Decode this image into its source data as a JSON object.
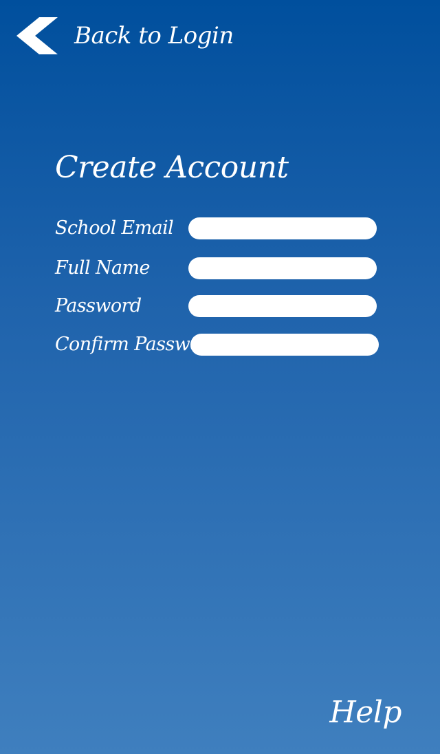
{
  "navigation": {
    "back_label": "Back to Login",
    "back_icon": "chevron-left-icon"
  },
  "page": {
    "title": "Create Account"
  },
  "form": {
    "fields": [
      {
        "label": "School Email",
        "value": ""
      },
      {
        "label": "Full Name",
        "value": ""
      },
      {
        "label": "Password",
        "value": ""
      },
      {
        "label": "Confirm Password",
        "value": ""
      }
    ]
  },
  "footer": {
    "help_label": "Help"
  },
  "colors": {
    "background_top": "#004f9d",
    "background_bottom": "#3f7fbe",
    "text": "#ffffff",
    "input_fill": "#ffffff"
  }
}
